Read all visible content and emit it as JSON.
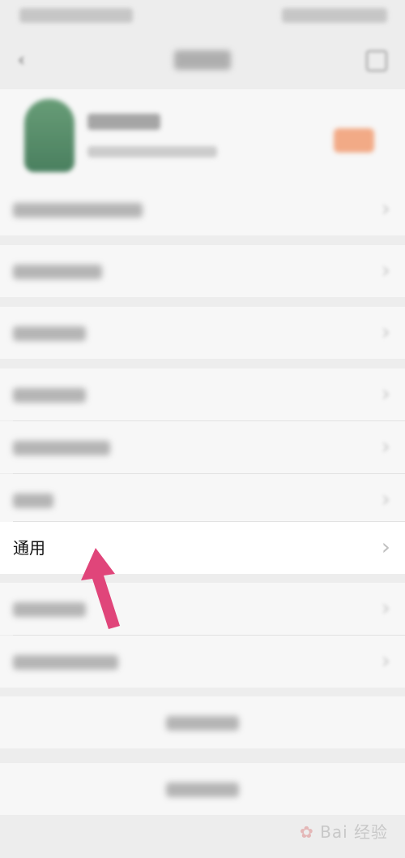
{
  "settings": {
    "general_label": "通用"
  },
  "watermark": {
    "text": "Bai 经验"
  },
  "colors": {
    "page_background": "#ededed",
    "row_background": "#f7f7f7",
    "highlight_row": "#ffffff",
    "arrow": "#e0457a",
    "profile_badge": "#f2a27a"
  },
  "icons": {
    "back": "back-arrow-icon",
    "menu": "more-menu-icon",
    "row_chevron": "chevron-right-icon",
    "annotation": "pointer-arrow"
  }
}
